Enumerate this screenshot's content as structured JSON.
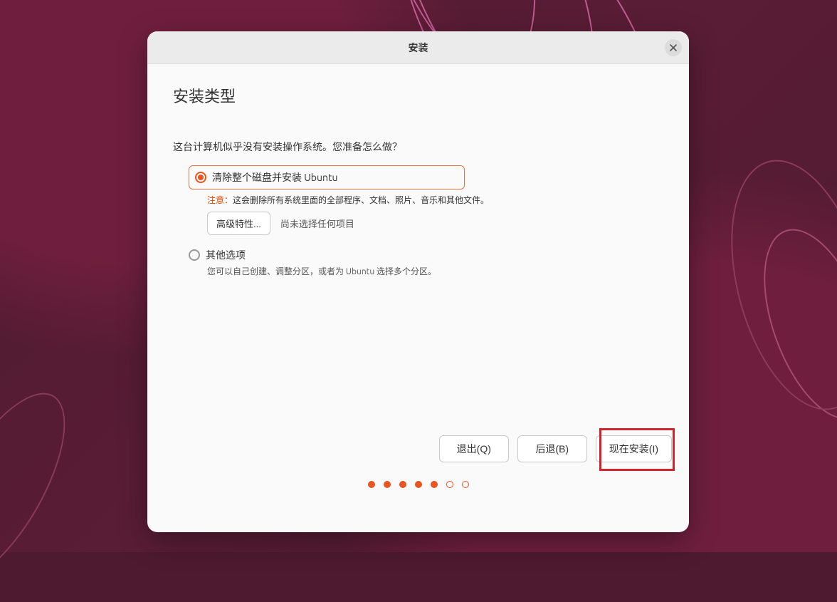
{
  "window": {
    "title": "安装"
  },
  "page": {
    "heading": "安装类型",
    "prompt": "这台计算机似乎没有安装操作系统。您准备怎么做？"
  },
  "options": {
    "erase": {
      "label": "清除整个磁盘并安装 Ubuntu",
      "warning_label": "注意：",
      "warning_text": "这会删除所有系统里面的全部程序、文档、照片、音乐和其他文件。",
      "advanced_button": "高级特性...",
      "advanced_status": "尚未选择任何项目"
    },
    "other": {
      "label": "其他选项",
      "description": "您可以自己创建、调整分区，或者为 Ubuntu 选择多个分区。"
    }
  },
  "buttons": {
    "quit": "退出(Q)",
    "back": "后退(B)",
    "install": "现在安装(I)"
  },
  "progress": {
    "total": 7,
    "current": 5
  }
}
